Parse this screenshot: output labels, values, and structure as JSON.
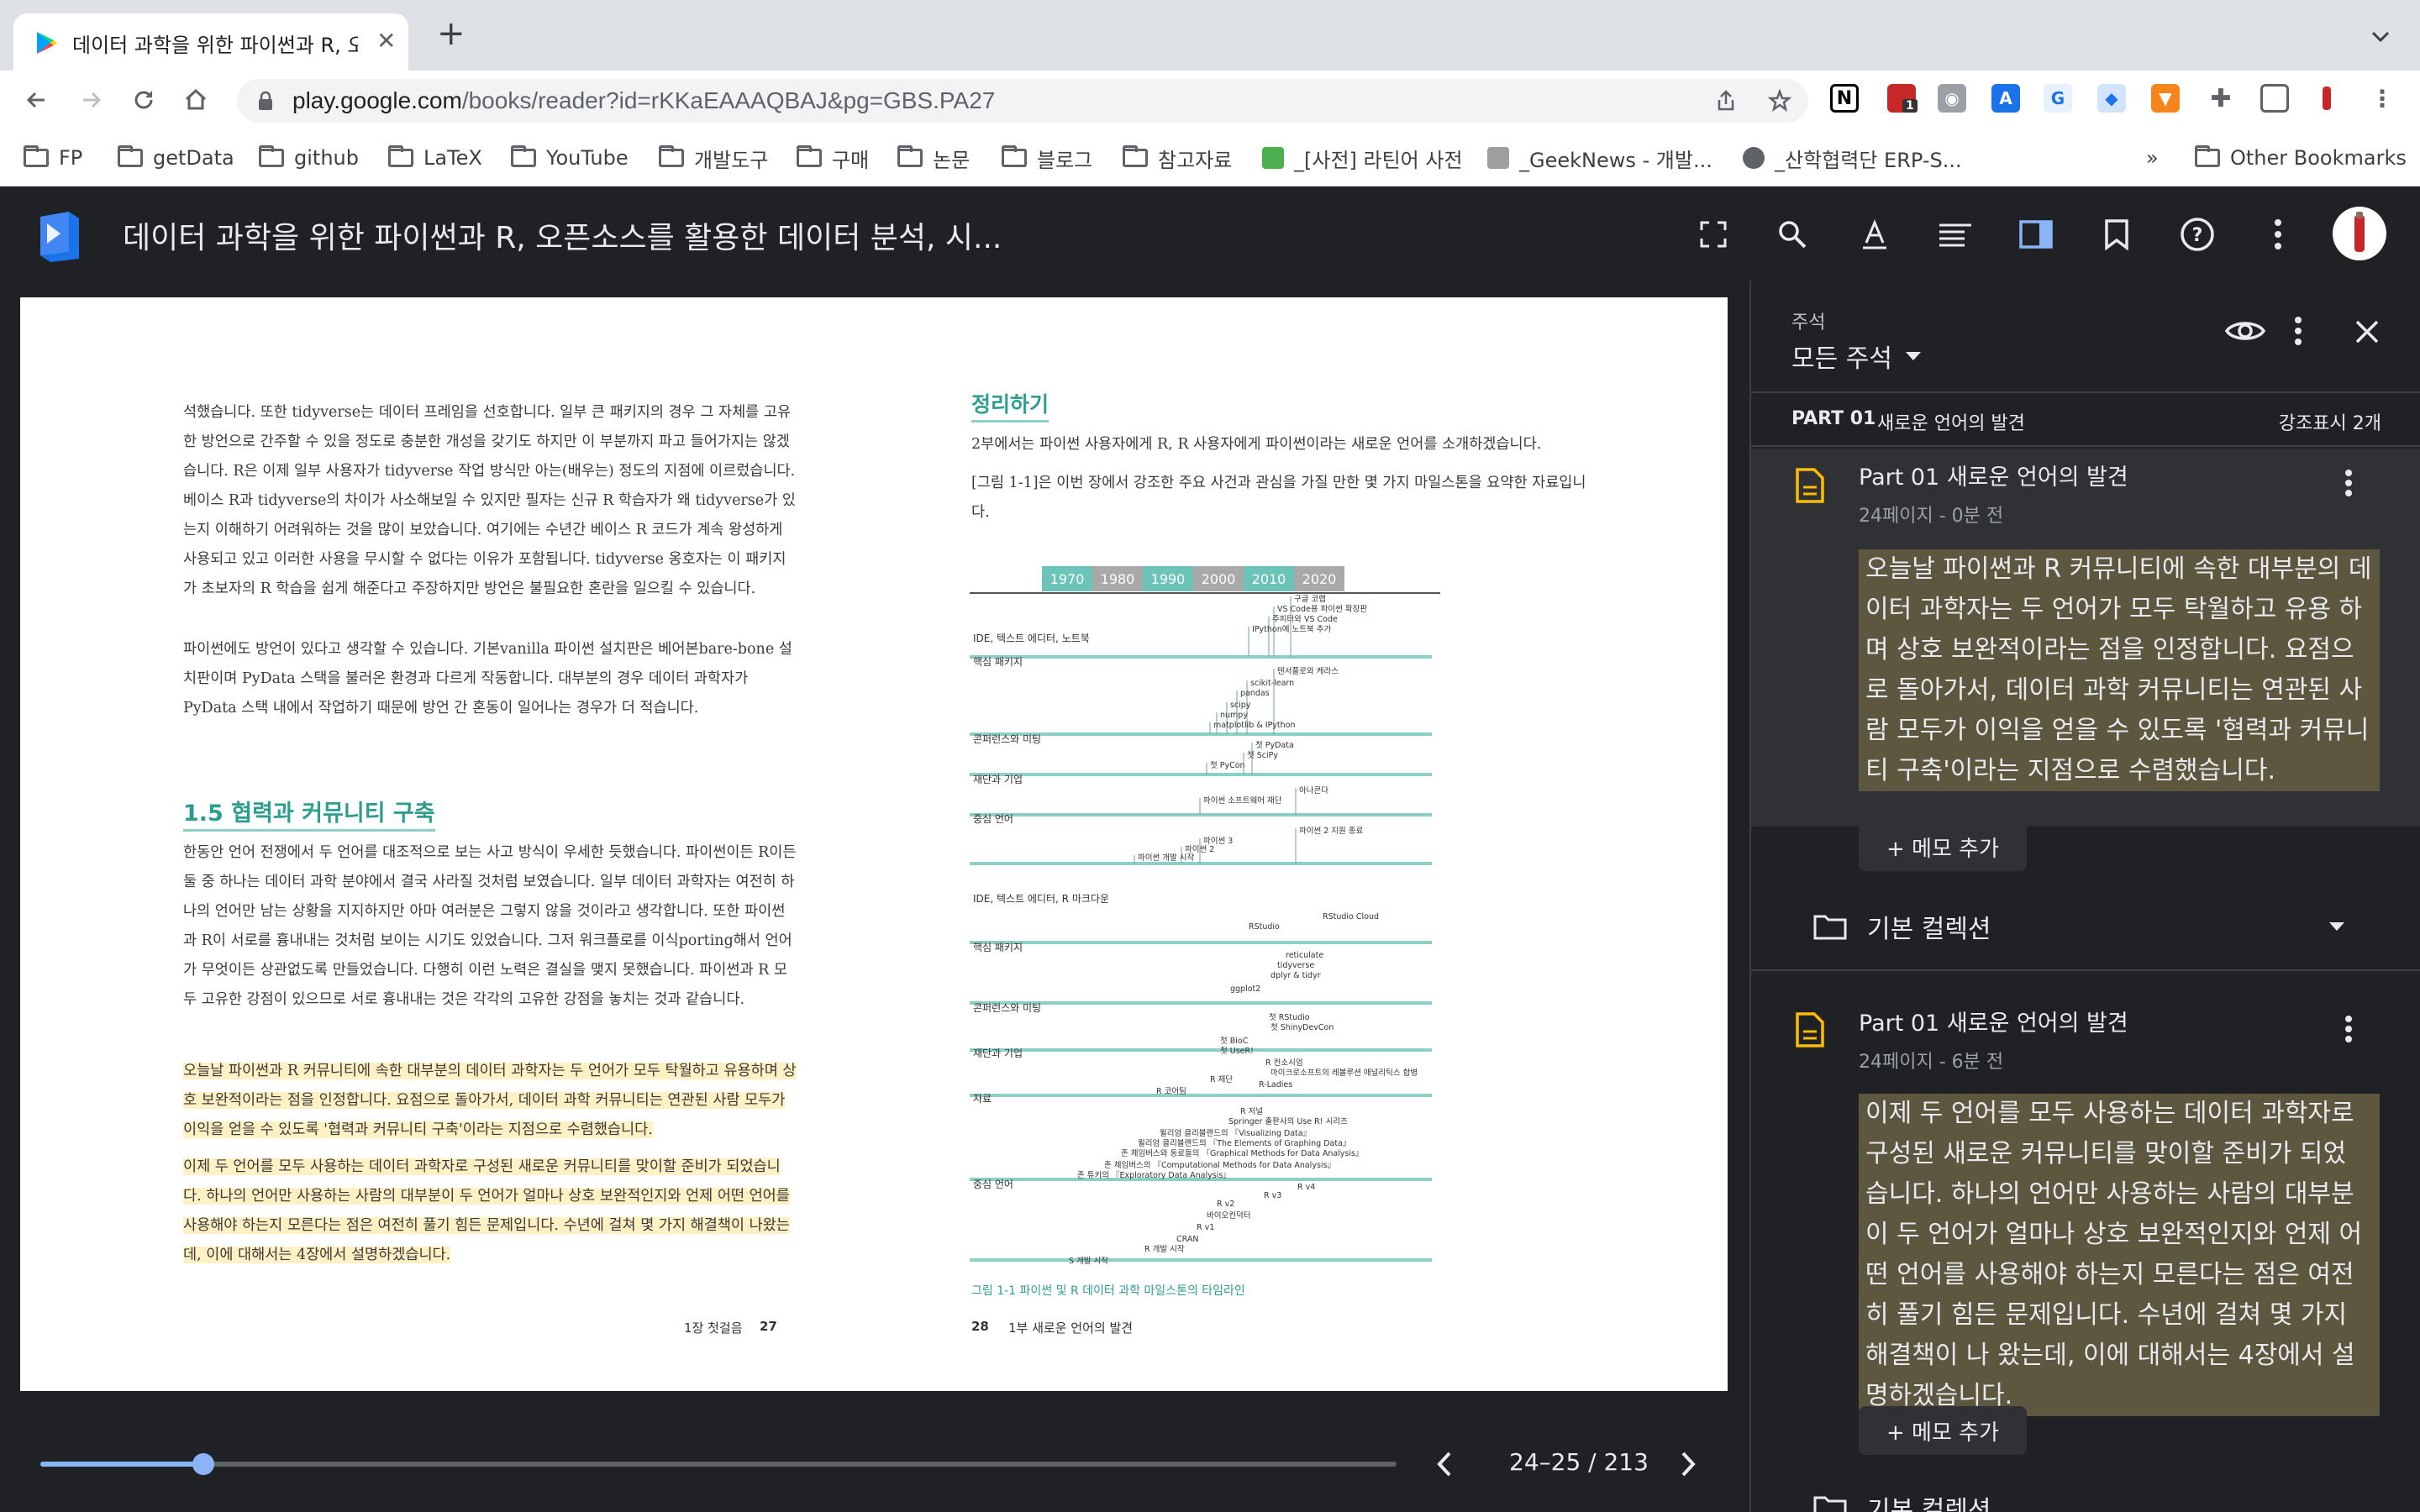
{
  "browser": {
    "tab_title": "데이터 과학을 위한 파이썬과 R, 오픈",
    "url_host": "play.google.com",
    "url_path": "/books/reader?id=rKKaEAAAQBAJ&pg=GBS.PA27",
    "ext_badge": "1"
  },
  "bookmarks": [
    {
      "label": "FP"
    },
    {
      "label": "getData"
    },
    {
      "label": "github"
    },
    {
      "label": "LaTeX"
    },
    {
      "label": "YouTube"
    },
    {
      "label": "개발도구"
    },
    {
      "label": "구매"
    },
    {
      "label": "논문"
    },
    {
      "label": "블로그"
    },
    {
      "label": "참고자료"
    },
    {
      "label": "_[사전] 라틴어 사전"
    },
    {
      "label": "_GeekNews - 개발..."
    },
    {
      "label": "_산학협력단 ERP-S..."
    }
  ],
  "bookmarks_more": "»",
  "other_bookmarks": "Other Bookmarks",
  "reader": {
    "book_title": "데이터 과학을 위한 파이썬과 R, 오픈소스를 활용한 데이터 분석, 시...",
    "page_indicator": "24–25 / 213",
    "progress": 0.12
  },
  "page_left": {
    "para1": "석했습니다. 또한 tidyverse는 데이터 프레임을 선호합니다. 일부 큰 패키지의 경우 그 자체를 고유한 방언으로 간주할 수 있을 정도로 충분한 개성을 갖기도 하지만 이 부분까지 파고 들어가지는 않겠습니다. R은 이제 일부 사용자가 tidyverse 작업 방식만 아는(배우는) 정도의 지점에 이르렀습니다. 베이스 R과 tidyverse의 차이가 사소해보일 수 있지만 필자는 신규 R 학습자가 왜 tidyverse가 있는지 이해하기 어려워하는 것을 많이 보았습니다. 여기에는 수년간 베이스 R 코드가 계속 왕성하게 사용되고 있고 이러한 사용을 무시할 수 없다는 이유가 포함됩니다. tidyverse 옹호자는 이 패키지가 초보자의 R 학습을 쉽게 해준다고 주장하지만 방언은 불필요한 혼란을 일으킬 수 있습니다.",
    "para2": "파이썬에도 방언이 있다고 생각할 수 있습니다. 기본vanilla 파이썬 설치판은 베어본bare-bone 설치판이며 PyData 스택을 불러온 환경과 다르게 작동합니다. 대부분의 경우 데이터 과학자가 PyData 스택 내에서 작업하기 때문에 방언 간 혼동이 일어나는 경우가 더 적습니다.",
    "section_heading": "1.5 협력과 커뮤니티 구축",
    "para3": "한동안 언어 전쟁에서 두 언어를 대조적으로 보는 사고 방식이 우세한 듯했습니다. 파이썬이든 R이든 둘 중 하나는 데이터 과학 분야에서 결국 사라질 것처럼 보였습니다. 일부 데이터 과학자는 여전히 하나의 언어만 남는 상황을 지지하지만 아마 여러분은 그렇지 않을 것이라고 생각합니다. 또한 파이썬과 R이 서로를 흉내내는 것처럼 보이는 시기도 있었습니다. 그저 워크플로를 이식porting해서 언어가 무엇이든 상관없도록 만들었습니다. 다행히 이런 노력은 결실을 맺지 못했습니다. 파이썬과 R 모두 고유한 강점이 있으므로 서로 흉내내는 것은 각각의 고유한 강점을 놓치는 것과 같습니다.",
    "highlight1": "오늘날 파이썬과 R 커뮤니티에 속한 대부분의 데이터 과학자는 두 언어가 모두 탁월하고 유용하며 상호 보완적이라는 점을 인정합니다. 요점으로 돌아가서, 데이터 과학 커뮤니티는 연관된 사람 모두가 이익을 얻을 수 있도록 '협력과 커뮤니티 구축'이라는 지점으로 수렴했습니다.",
    "highlight2": "이제 두 언어를 모두 사용하는 데이터 과학자로 구성된 새로운 커뮤니티를 맞이할 준비가 되었습니다. 하나의 언어만 사용하는 사람의 대부분이 두 언어가 얼마나 상호 보완적인지와 언제 어떤 언어를 사용해야 하는지 모른다는 점은 여전히 풀기 힘든 문제입니다. 수년에 걸쳐 몇 가지 해결책이 나왔는데, 이에 대해서는 4장에서 설명하겠습니다.",
    "footer_chapter": "1장 첫걸음",
    "footer_num": "27"
  },
  "page_right": {
    "heading": "정리하기",
    "para1": "2부에서는 파이썬 사용자에게 R, R 사용자에게 파이썬이라는 새로운 언어를 소개하겠습니다.",
    "para2": "[그림 1-1]은 이번 장에서 강조한 주요 사건과 관심을 가질 만한 몇 가지 마일스톤을 요약한 자료입니다.",
    "figure_caption": "그림 1-1 파이썬 및 R 데이터 과학 마일스톤의 타임라인",
    "footer_num": "28",
    "footer_chapter": "1부 새로운 언어의 발견"
  },
  "timeline": {
    "years": [
      "1970",
      "1980",
      "1990",
      "2000",
      "2010",
      "2020"
    ],
    "year_colors": [
      "#6cc3b7",
      "#a9a9a9",
      "#6cc3b7",
      "#a9a9a9",
      "#6cc3b7",
      "#a9a9a9"
    ],
    "python_rows": [
      "IDE, 텍스트 에디터, 노트북",
      "핵심 패키지",
      "콘퍼런스와 미팅",
      "재단과 기업",
      "중심 언어"
    ],
    "r_rows": [
      "IDE, 텍스트 에디터, R 마크다운",
      "핵심 패키지",
      "콘퍼런스와 미팅",
      "재단과 기업",
      "자료",
      "중심 언어"
    ],
    "py_events": [
      "구글 코랩",
      "VS Code용 파이썬 확장판",
      "주피터와 VS Code",
      "IPython에 노트북 추가",
      "텐서플로와 케라스",
      "scikit-learn",
      "pandas",
      "scipy",
      "numpy",
      "matplotlib & IPython",
      "첫 PyData",
      "첫 SciPy",
      "첫 PyCon",
      "아나콘다",
      "파이썬 소프트웨어 재단",
      "파이썬 2 지원 종료",
      "파이썬 3",
      "파이썬 2",
      "파이썬 개발 시작"
    ],
    "r_events": [
      "RStudio Cloud",
      "RStudio",
      "reticulate",
      "tidyverse",
      "dplyr & tidyr",
      "ggplot2",
      "첫 RStudio",
      "첫 ShinyDevCon",
      "첫 BioC",
      "첫 UseR!",
      "R 컨소시엄",
      "마이크로소프트의 레볼루션 애널리틱스 합병",
      "R-Ladies",
      "R 재단",
      "R 코어팀",
      "R 저널",
      "Springer 출판사의 Use R! 시리즈",
      "윌리엄 클리블랜드의 『Visualizing Data』",
      "윌리엄 클리블랜드의 『The Elements of Graphing Data』",
      "존 체임버스와 동료들의 『Graphical Methods for Data Analysis』",
      "존 체임버스의 『Computational Methods for Data Analysis』",
      "존 튜키의 『Exploratory Data Analysis』",
      "R v4",
      "R v3",
      "R v2",
      "바이오컨덕터",
      "R v1",
      "CRAN",
      "R 개발 시작",
      "S 개발 시작"
    ]
  },
  "panel": {
    "label": "주석",
    "filter": "모든 주석",
    "section_part": "PART 01",
    "section_title": "새로운 언어의 발견",
    "highlight_count": "강조표시 2개",
    "annotations": [
      {
        "part": "Part 01",
        "title": "새로운 언어의 발견",
        "meta": "24페이지 - 0분 전",
        "quote": "오늘날 파이썬과 R 커뮤니티에 속한 대부분의 데이터 과학자는 두 언어가 모두 탁월하고 유용 하며 상호 보완적이라는 점을 인정합니다. 요점으로 돌아가서, 데이터 과학 커뮤니티는 연관된 사람 모두가 이익을 얻을 수 있도록 '협력과 커뮤니티 구축'이라는 지점으로 수렴했습니다.",
        "memo": "+ 메모 추가",
        "collection": "기본 컬렉션"
      },
      {
        "part": "Part 01",
        "title": "새로운 언어의 발견",
        "meta": "24페이지 - 6분 전",
        "quote": "이제 두 언어를 모두 사용하는 데이터 과학자로 구성된 새로운 커뮤니티를 맞이할 준비가 되었 습니다. 하나의 언어만 사용하는 사람의 대부분이 두 언어가 얼마나 상호 보완적인지와 언제 어 떤 언어를 사용해야 하는지 모른다는 점은 여전히 풀기 힘든 문제입니다. 수년에 걸쳐 몇 가지 해결책이 나 왔는데, 이에 대해서는 4장에서 설명하겠습니다.",
        "memo": "+ 메모 추가",
        "collection": "기본 컬렉션"
      }
    ]
  }
}
